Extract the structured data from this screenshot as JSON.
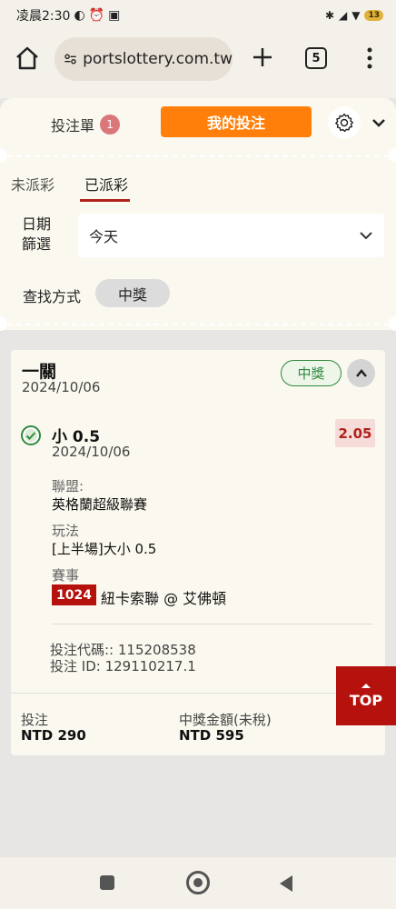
{
  "status_bar": {
    "time": "凌晨2:30",
    "battery": "13"
  },
  "browser": {
    "url": "portslottery.com.tw",
    "tab_count": "5"
  },
  "header": {
    "betslip_label": "投注單",
    "betslip_count": "1",
    "mybets_label": "我的投注"
  },
  "sub_tabs": [
    {
      "label": "未派彩"
    },
    {
      "label": "已派彩"
    }
  ],
  "filter": {
    "date_label": "日期 篩選",
    "date_value": "今天",
    "search_label": "查找方式",
    "search_chip": "中獎"
  },
  "bet": {
    "type": "一關",
    "date": "2024/10/06",
    "status": "中獎",
    "selection": {
      "name": "小 0.5",
      "date": "2024/10/06",
      "odds": "2.05"
    },
    "league_label": "聯盟:",
    "league": "英格蘭超級聯賽",
    "market_label": "玩法",
    "market": "[上半場]大小 0.5",
    "event_label": "賽事",
    "match_id": "1024",
    "match_name": "紐卡索聯 @ 艾佛頓",
    "bet_code": "投注代碼:: 115208538",
    "bet_id": "投注 ID: 129110217.1",
    "stake_label": "投注",
    "stake": "NTD 290",
    "payout_label": "中獎金額(未稅)",
    "payout": "NTD 595"
  },
  "top_button": "TOP",
  "colors": {
    "accent_orange": "#ff7f0a",
    "brand_red": "#b5120e",
    "win_green": "#2f8a3e"
  }
}
